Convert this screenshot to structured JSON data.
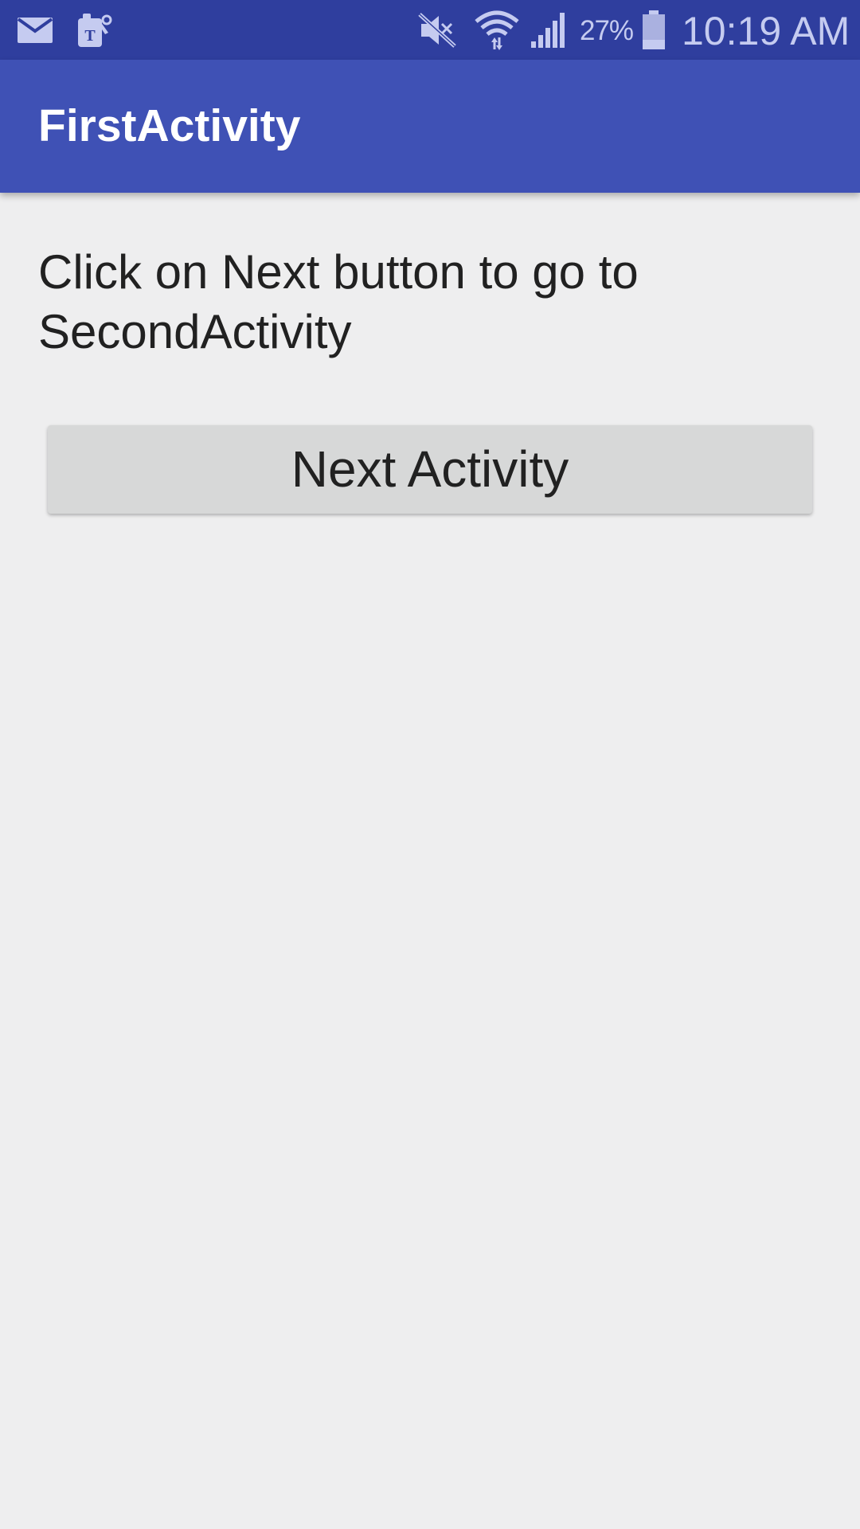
{
  "status_bar": {
    "battery_percent": "27%",
    "time": "10:19 AM",
    "icons": [
      "email-icon",
      "tmobile-app-icon",
      "mute-icon",
      "wifi-icon",
      "signal-icon",
      "battery-icon"
    ]
  },
  "app_bar": {
    "title": "FirstActivity"
  },
  "main": {
    "instruction": "Click on Next button to go to SecondActivity",
    "next_button_label": "Next Activity"
  },
  "colors": {
    "status_bar": "#2f3e9e",
    "app_bar": "#3f51b5",
    "background": "#eeeeef",
    "button": "#d7d8d8",
    "text": "#212121"
  }
}
